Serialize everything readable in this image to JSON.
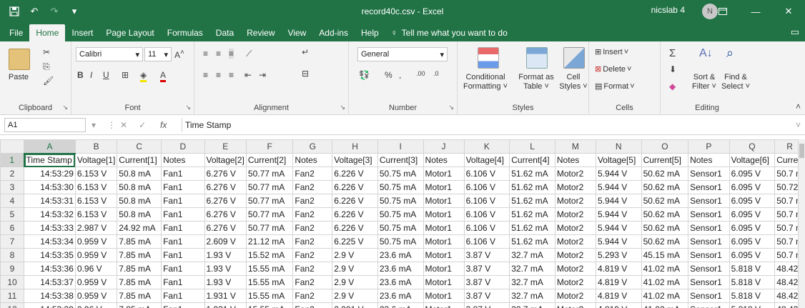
{
  "title": {
    "file_name": "record40c.csv  -  Excel",
    "account": "nicslab 4",
    "avatar_initial": "N"
  },
  "tabs": [
    {
      "label": "File",
      "active": false
    },
    {
      "label": "Home",
      "active": true
    },
    {
      "label": "Insert",
      "active": false
    },
    {
      "label": "Page Layout",
      "active": false
    },
    {
      "label": "Formulas",
      "active": false
    },
    {
      "label": "Data",
      "active": false
    },
    {
      "label": "Review",
      "active": false
    },
    {
      "label": "View",
      "active": false
    },
    {
      "label": "Add-ins",
      "active": false
    },
    {
      "label": "Help",
      "active": false
    }
  ],
  "tell_me": "Tell me what you want to do",
  "ribbon": {
    "clipboard": {
      "label": "Clipboard",
      "paste": "Paste"
    },
    "font": {
      "label": "Font",
      "name": "Calibri",
      "size": "11",
      "bold": "B",
      "italic": "I",
      "underline": "U"
    },
    "alignment": {
      "label": "Alignment"
    },
    "number": {
      "label": "Number",
      "format": "General"
    },
    "styles": {
      "label": "Styles",
      "conditional": [
        "Conditional",
        "Formatting ˅"
      ],
      "format_as_table": [
        "Format as",
        "Table ˅"
      ],
      "cell_styles": [
        "Cell",
        "Styles ˅"
      ]
    },
    "cells": {
      "label": "Cells",
      "insert": "Insert",
      "delete": "Delete",
      "format": "Format"
    },
    "editing": {
      "label": "Editing",
      "sort_filter": [
        "Sort &",
        "Filter ˅"
      ],
      "find_select": [
        "Find &",
        "Select ˅"
      ]
    }
  },
  "formula_bar": {
    "name_box": "A1",
    "fx": "fx",
    "content": "Time Stamp"
  },
  "sheet": {
    "columns": [
      "A",
      "B",
      "C",
      "D",
      "E",
      "F",
      "G",
      "H",
      "I",
      "J",
      "K",
      "L",
      "M",
      "N",
      "O",
      "P",
      "Q",
      "R"
    ],
    "rows": [
      {
        "n": "1",
        "cells": [
          "Time Stamp",
          "Voltage[1]",
          "Current[1]",
          "Notes",
          "Voltage[2]",
          "Current[2]",
          "Notes",
          "Voltage[3]",
          "Current[3]",
          "Notes",
          "Voltage[4]",
          "Current[4]",
          "Notes",
          "Voltage[5]",
          "Current[5]",
          "Notes",
          "Voltage[6]",
          "Curren"
        ]
      },
      {
        "n": "2",
        "cells": [
          "14:53:29",
          "6.153 V",
          "50.8 mA",
          "Fan1",
          "6.276 V",
          "50.77 mA",
          "Fan2",
          "6.226 V",
          "50.75 mA",
          "Motor1",
          "6.106 V",
          "51.62 mA",
          "Motor2",
          "5.944 V",
          "50.62 mA",
          "Sensor1",
          "6.095 V",
          "50.7 m"
        ]
      },
      {
        "n": "3",
        "cells": [
          "14:53:30",
          "6.153 V",
          "50.8 mA",
          "Fan1",
          "6.276 V",
          "50.77 mA",
          "Fan2",
          "6.226 V",
          "50.75 mA",
          "Motor1",
          "6.106 V",
          "51.62 mA",
          "Motor2",
          "5.944 V",
          "50.62 mA",
          "Sensor1",
          "6.095 V",
          "50.72"
        ]
      },
      {
        "n": "4",
        "cells": [
          "14:53:31",
          "6.153 V",
          "50.8 mA",
          "Fan1",
          "6.276 V",
          "50.77 mA",
          "Fan2",
          "6.226 V",
          "50.75 mA",
          "Motor1",
          "6.106 V",
          "51.62 mA",
          "Motor2",
          "5.944 V",
          "50.62 mA",
          "Sensor1",
          "6.095 V",
          "50.7 m"
        ]
      },
      {
        "n": "5",
        "cells": [
          "14:53:32",
          "6.153 V",
          "50.8 mA",
          "Fan1",
          "6.276 V",
          "50.77 mA",
          "Fan2",
          "6.226 V",
          "50.75 mA",
          "Motor1",
          "6.106 V",
          "51.62 mA",
          "Motor2",
          "5.944 V",
          "50.62 mA",
          "Sensor1",
          "6.095 V",
          "50.7 m"
        ]
      },
      {
        "n": "6",
        "cells": [
          "14:53:33",
          "2.987 V",
          "24.92 mA",
          "Fan1",
          "6.276 V",
          "50.77 mA",
          "Fan2",
          "6.226 V",
          "50.75 mA",
          "Motor1",
          "6.106 V",
          "51.62 mA",
          "Motor2",
          "5.944 V",
          "50.62 mA",
          "Sensor1",
          "6.095 V",
          "50.7 m"
        ]
      },
      {
        "n": "7",
        "cells": [
          "14:53:34",
          "0.959 V",
          "7.85 mA",
          "Fan1",
          "2.609 V",
          "21.12 mA",
          "Fan2",
          "6.225 V",
          "50.75 mA",
          "Motor1",
          "6.106 V",
          "51.62 mA",
          "Motor2",
          "5.944 V",
          "50.62 mA",
          "Sensor1",
          "6.095 V",
          "50.7 m"
        ]
      },
      {
        "n": "8",
        "cells": [
          "14:53:35",
          "0.959 V",
          "7.85 mA",
          "Fan1",
          "1.93 V",
          "15.52 mA",
          "Fan2",
          "2.9 V",
          "23.6 mA",
          "Motor1",
          "3.87 V",
          "32.7 mA",
          "Motor2",
          "5.293 V",
          "45.15 mA",
          "Sensor1",
          "6.095 V",
          "50.7 m"
        ]
      },
      {
        "n": "9",
        "cells": [
          "14:53:36",
          "0.96 V",
          "7.85 mA",
          "Fan1",
          "1.93 V",
          "15.55 mA",
          "Fan2",
          "2.9 V",
          "23.6 mA",
          "Motor1",
          "3.87 V",
          "32.7 mA",
          "Motor2",
          "4.819 V",
          "41.02 mA",
          "Sensor1",
          "5.818 V",
          "48.42"
        ]
      },
      {
        "n": "10",
        "cells": [
          "14:53:37",
          "0.959 V",
          "7.85 mA",
          "Fan1",
          "1.93 V",
          "15.55 mA",
          "Fan2",
          "2.9 V",
          "23.6 mA",
          "Motor1",
          "3.87 V",
          "32.7 mA",
          "Motor2",
          "4.819 V",
          "41.02 mA",
          "Sensor1",
          "5.818 V",
          "48.42"
        ]
      },
      {
        "n": "11",
        "cells": [
          "14:53:38",
          "0.959 V",
          "7.85 mA",
          "Fan1",
          "1.931 V",
          "15.55 mA",
          "Fan2",
          "2.9 V",
          "23.6 mA",
          "Motor1",
          "3.87 V",
          "32.7 mA",
          "Motor2",
          "4.819 V",
          "41.02 mA",
          "Sensor1",
          "5.818 V",
          "48.42"
        ]
      },
      {
        "n": "12",
        "cells": [
          "14:53:39",
          "0.96 V",
          "7.85 mA",
          "Fan1",
          "1.931 V",
          "15.55 mA",
          "Fan2",
          "2.901 V",
          "23.6 mA",
          "Motor1",
          "3.87 V",
          "32.7 mA",
          "Motor2",
          "4.819 V",
          "41.02 mA",
          "Sensor1",
          "5.818 V",
          "48.42"
        ]
      }
    ]
  }
}
